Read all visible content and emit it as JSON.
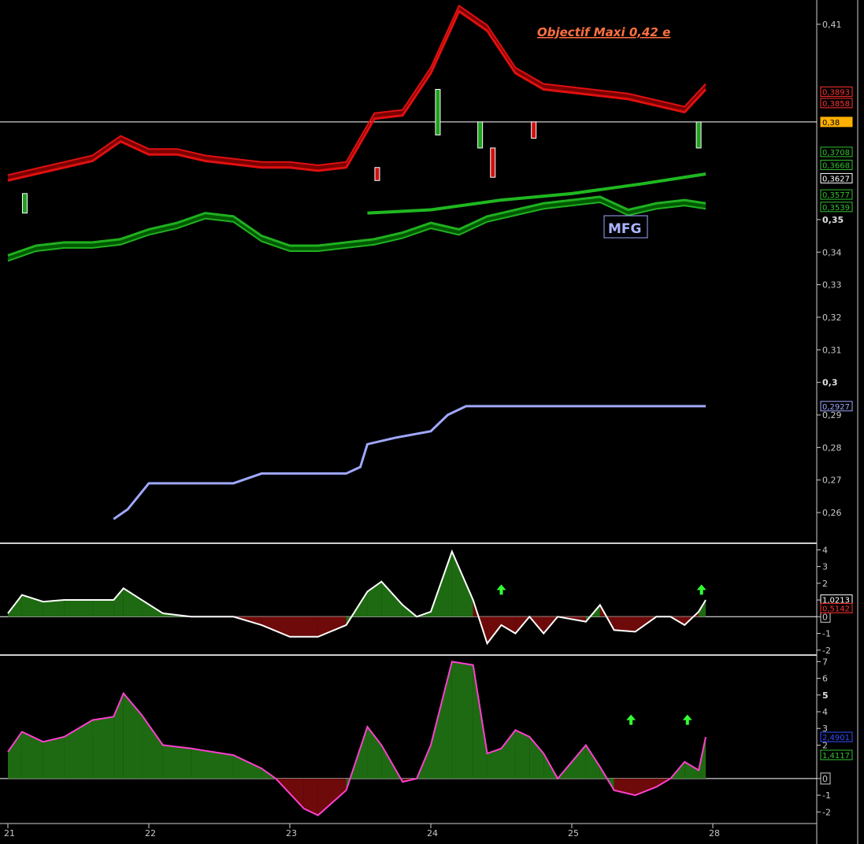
{
  "chart_data": [
    {
      "type": "line",
      "panel": "price",
      "annotation": "Objectif Maxi 0,42 e",
      "label": "MFG",
      "ylim": [
        0.253,
        0.416
      ],
      "x_ticks": [
        "21",
        "22",
        "23",
        "24",
        "25",
        "28"
      ],
      "y_ticks": [
        {
          "v": 0.41,
          "label": "0,41"
        },
        {
          "v": 0.35,
          "label": "0,35",
          "bold": true
        },
        {
          "v": 0.34,
          "label": "0,34"
        },
        {
          "v": 0.33,
          "label": "0,33"
        },
        {
          "v": 0.32,
          "label": "0,32"
        },
        {
          "v": 0.31,
          "label": "0,31"
        },
        {
          "v": 0.3,
          "label": "0,3",
          "bold": true
        },
        {
          "v": 0.29,
          "label": "0,29"
        },
        {
          "v": 0.28,
          "label": "0,28"
        },
        {
          "v": 0.27,
          "label": "0,27"
        },
        {
          "v": 0.26,
          "label": "0,26"
        }
      ],
      "reference_line": 0.38,
      "price_labels": [
        {
          "v": 0.3893,
          "label": "0,3893",
          "color": "#ff3030"
        },
        {
          "v": 0.3858,
          "label": "0,3858",
          "color": "#ff3030"
        },
        {
          "v": 0.38,
          "label": "0,38",
          "color": "#000000",
          "bg": "#ffb000"
        },
        {
          "v": 0.3708,
          "label": "0,3708",
          "color": "#30c030"
        },
        {
          "v": 0.3668,
          "label": "0,3668",
          "color": "#30c030"
        },
        {
          "v": 0.3627,
          "label": "0,3627",
          "color": "#ffffff"
        },
        {
          "v": 0.3577,
          "label": "0,3577",
          "color": "#30c030"
        },
        {
          "v": 0.3539,
          "label": "0,3539",
          "color": "#30c030"
        },
        {
          "v": 0.2927,
          "label": "0,2927",
          "color": "#9fa8ff"
        }
      ],
      "series": [
        {
          "color": "#e01010",
          "x": [
            21.0,
            21.2,
            21.4,
            21.6,
            21.8,
            22.0,
            22.2,
            22.4,
            22.6,
            22.8,
            23.0,
            23.2,
            23.4,
            23.6,
            23.8,
            24.0,
            24.2,
            24.4,
            24.6,
            24.8,
            25.0,
            25.2,
            25.4,
            25.6,
            25.8,
            25.95
          ],
          "values": [
            0.362,
            0.364,
            0.366,
            0.368,
            0.374,
            0.37,
            0.37,
            0.368,
            0.367,
            0.366,
            0.366,
            0.365,
            0.366,
            0.381,
            0.382,
            0.395,
            0.414,
            0.408,
            0.395,
            0.39,
            0.389,
            0.388,
            0.387,
            0.385,
            0.383,
            0.39
          ]
        },
        {
          "color": "#20b020",
          "x": [
            21.0,
            21.2,
            21.4,
            21.6,
            21.8,
            22.0,
            22.2,
            22.4,
            22.6,
            22.8,
            23.0,
            23.2,
            23.4,
            23.6,
            23.8,
            24.0,
            24.2,
            24.4,
            24.6,
            24.8,
            25.0,
            25.2,
            25.4,
            25.6,
            25.8,
            25.95
          ],
          "values": [
            0.339,
            0.342,
            0.343,
            0.343,
            0.344,
            0.347,
            0.349,
            0.352,
            0.351,
            0.345,
            0.342,
            0.342,
            0.343,
            0.344,
            0.346,
            0.349,
            0.347,
            0.351,
            0.353,
            0.355,
            0.356,
            0.357,
            0.353,
            0.355,
            0.356,
            0.355
          ]
        },
        {
          "color": "#1fb81f",
          "x": [
            23.55,
            24.0,
            24.5,
            25.0,
            25.5,
            25.95
          ],
          "values": [
            0.352,
            0.353,
            0.356,
            0.358,
            0.361,
            0.364
          ]
        },
        {
          "color": "#9fa8ff",
          "x": [
            21.75,
            21.85,
            22.0,
            22.6,
            22.8,
            23.4,
            23.5,
            23.55,
            23.75,
            24.0,
            24.12,
            24.25,
            25.95
          ],
          "values": [
            0.258,
            0.261,
            0.269,
            0.269,
            0.272,
            0.272,
            0.274,
            0.281,
            0.283,
            0.285,
            0.29,
            0.2927,
            0.2927
          ]
        }
      ]
    },
    {
      "type": "area",
      "panel": "oscillator",
      "ylim": [
        -2.2,
        4.3
      ],
      "y_ticks": [
        {
          "v": 4,
          "label": "4"
        },
        {
          "v": 3,
          "label": "3"
        },
        {
          "v": 2,
          "label": "2"
        },
        {
          "v": 1,
          "label": "1"
        },
        {
          "v": 0,
          "label": "0",
          "boxed": true
        },
        {
          "v": -1,
          "label": "-1"
        },
        {
          "v": -2,
          "label": "-2"
        }
      ],
      "price_labels": [
        {
          "v": 1.0213,
          "label": "1,0213",
          "color": "#ffffff"
        },
        {
          "v": 0.5142,
          "label": "0,5142",
          "color": "#ff3030"
        }
      ],
      "x": [
        21.0,
        21.1,
        21.25,
        21.4,
        21.6,
        21.75,
        21.82,
        21.95,
        22.1,
        22.3,
        22.6,
        22.8,
        23.0,
        23.2,
        23.4,
        23.55,
        23.65,
        23.8,
        23.9,
        24.0,
        24.15,
        24.3,
        24.4,
        24.5,
        24.6,
        24.7,
        24.8,
        24.9,
        25.1,
        25.2,
        25.3,
        25.45,
        25.6,
        25.7,
        25.8,
        25.9,
        25.95
      ],
      "values": [
        0.2,
        1.3,
        0.9,
        1.0,
        1.0,
        1.0,
        1.7,
        1.0,
        0.2,
        0.0,
        0.0,
        -0.5,
        -1.2,
        -1.2,
        -0.5,
        1.5,
        2.1,
        0.7,
        0.0,
        0.3,
        3.9,
        1.0,
        -1.6,
        -0.5,
        -1.0,
        0.0,
        -1.0,
        0.0,
        -0.3,
        0.7,
        -0.8,
        -0.9,
        0.0,
        0.0,
        -0.5,
        0.3,
        1.0
      ],
      "signal_arrows_x": [
        24.5,
        25.92
      ]
    },
    {
      "type": "area",
      "panel": "oscillator",
      "ylim": [
        -2.6,
        7.3
      ],
      "y_ticks": [
        {
          "v": 7,
          "label": "7"
        },
        {
          "v": 6,
          "label": "6"
        },
        {
          "v": 5,
          "label": "5",
          "bold": true
        },
        {
          "v": 4,
          "label": "4"
        },
        {
          "v": 3,
          "label": "3"
        },
        {
          "v": 2,
          "label": "2"
        },
        {
          "v": 0,
          "label": "0",
          "boxed": true
        },
        {
          "v": -1,
          "label": "-1"
        },
        {
          "v": -2,
          "label": "-2"
        }
      ],
      "price_labels": [
        {
          "v": 2.4901,
          "label": "2,4901",
          "color": "#3050ff"
        },
        {
          "v": 1.4117,
          "label": "1,4117",
          "color": "#30c030"
        }
      ],
      "x": [
        21.0,
        21.1,
        21.25,
        21.4,
        21.6,
        21.75,
        21.82,
        21.95,
        22.1,
        22.3,
        22.6,
        22.8,
        22.9,
        23.1,
        23.2,
        23.4,
        23.55,
        23.65,
        23.8,
        23.9,
        24.0,
        24.15,
        24.3,
        24.4,
        24.5,
        24.6,
        24.7,
        24.8,
        24.9,
        25.1,
        25.2,
        25.3,
        25.45,
        25.6,
        25.7,
        25.8,
        25.9,
        25.95
      ],
      "values": [
        1.6,
        2.8,
        2.2,
        2.5,
        3.5,
        3.7,
        5.1,
        3.8,
        2.0,
        1.8,
        1.4,
        0.6,
        0.0,
        -1.8,
        -2.2,
        -0.7,
        3.1,
        2.0,
        -0.2,
        0.0,
        2.0,
        7.0,
        6.8,
        1.5,
        1.8,
        2.9,
        2.5,
        1.5,
        0.0,
        2.0,
        0.7,
        -0.7,
        -1.0,
        -0.5,
        0.0,
        1.0,
        0.5,
        2.4901
      ],
      "signal_arrows_x": [
        25.42,
        25.82
      ]
    }
  ]
}
